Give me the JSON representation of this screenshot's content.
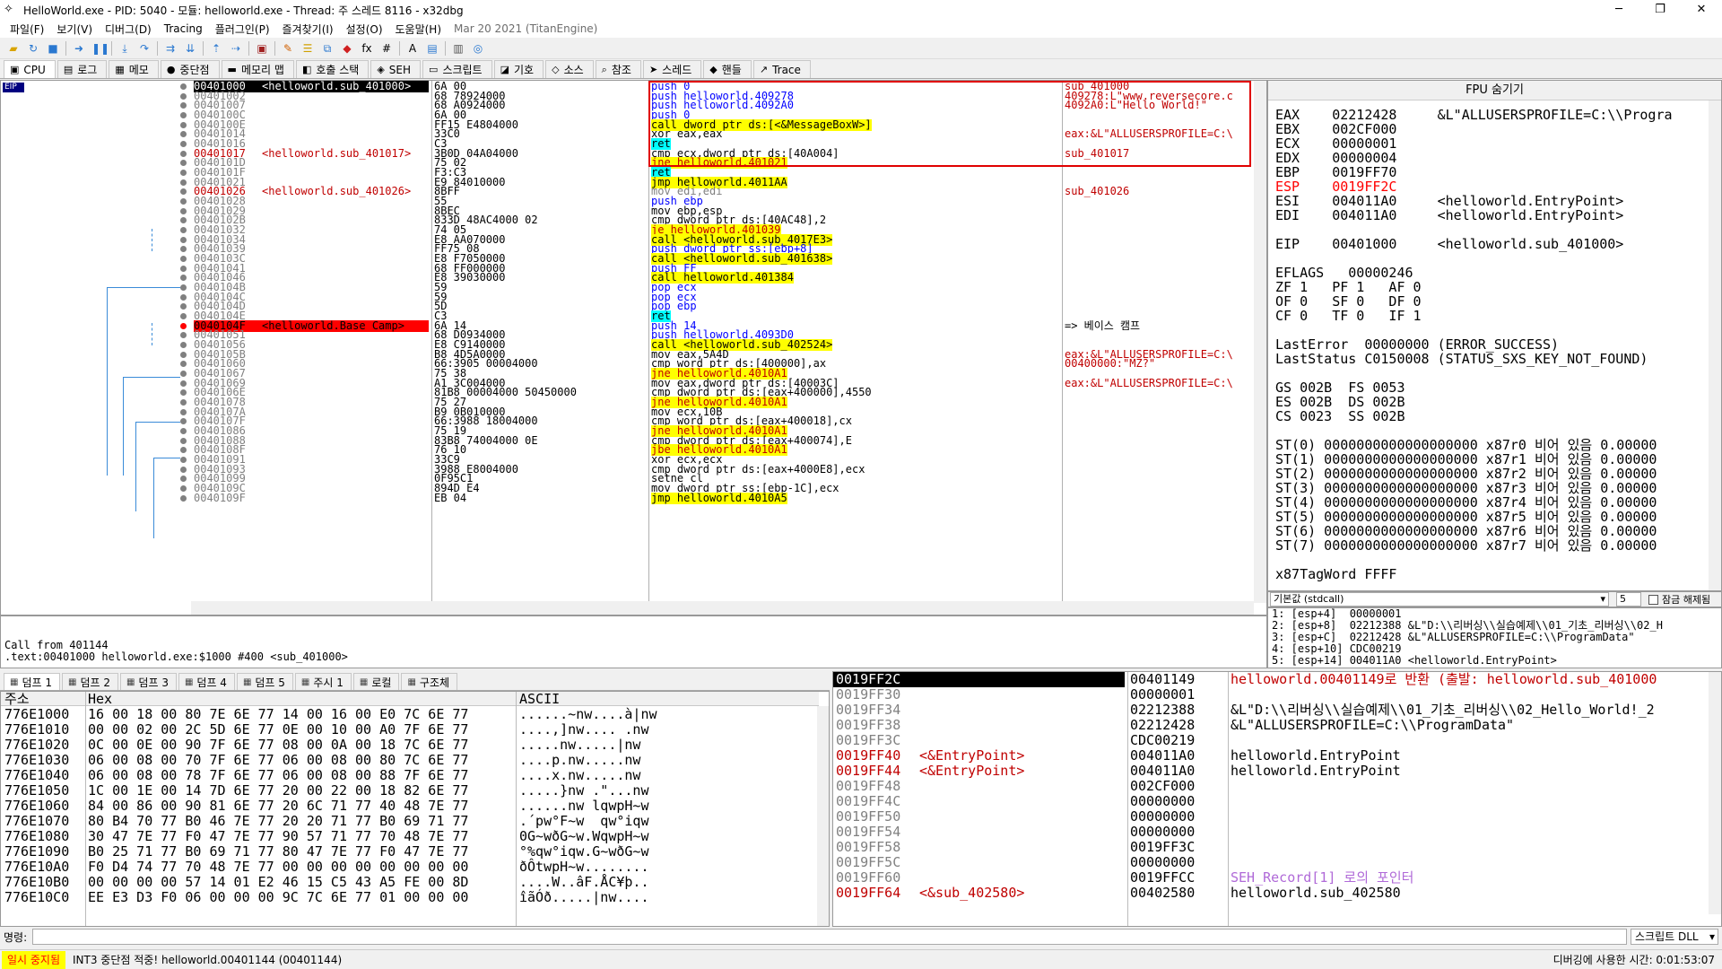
{
  "titlebar": {
    "title": "HelloWorld.exe - PID: 5040 - 모듈: helloworld.exe - Thread: 주 스레드 8116 - x32dbg",
    "minimize": "─",
    "maximize": "❐",
    "close": "✕"
  },
  "menu": [
    "파일(F)",
    "보기(V)",
    "디버그(D)",
    "Tracing",
    "플러그인(P)",
    "즐겨찾기(I)",
    "설정(O)",
    "도움말(H)"
  ],
  "menu_dim": "Mar 20 2021 (TitanEngine)",
  "tabs": [
    {
      "icon": "cpu-icon",
      "glyph": "▣",
      "label": "CPU"
    },
    {
      "icon": "log-icon",
      "glyph": "▤",
      "label": "로그"
    },
    {
      "icon": "notes-icon",
      "glyph": "▦",
      "label": "메모"
    },
    {
      "icon": "breakpoint-icon",
      "glyph": "●",
      "label": "중단점"
    },
    {
      "icon": "memory-icon",
      "glyph": "▬",
      "label": "메모리 맵"
    },
    {
      "icon": "callstack-icon",
      "glyph": "◧",
      "label": "호출 스택"
    },
    {
      "icon": "seh-icon",
      "glyph": "◈",
      "label": "SEH"
    },
    {
      "icon": "script-icon",
      "glyph": "▭",
      "label": "스크립트"
    },
    {
      "icon": "symbol-icon",
      "glyph": "◪",
      "label": "기호"
    },
    {
      "icon": "source-icon",
      "glyph": "◇",
      "label": "소스"
    },
    {
      "icon": "reference-icon",
      "glyph": "⌕",
      "label": "참조"
    },
    {
      "icon": "threads-icon",
      "glyph": "➤",
      "label": "스레드"
    },
    {
      "icon": "handles-icon",
      "glyph": "◆",
      "label": "핸들"
    },
    {
      "icon": "trace-icon",
      "glyph": "↗",
      "label": "Trace"
    }
  ],
  "cpu": {
    "eip_badge": "EIP",
    "rows": [
      {
        "addr": "00401000",
        "label": "<helloworld.sub_401000>",
        "bytes": "6A 00",
        "dis": "push 0",
        "op": "push",
        "cmt": "sub_401000",
        "eip": true
      },
      {
        "addr": "00401002",
        "bytes": "68 78924000",
        "dis": "push helloworld.409278",
        "op": "push",
        "cmt": "409278:L\"www.reversecore.c"
      },
      {
        "addr": "00401007",
        "bytes": "68 A0924000",
        "dis": "push helloworld.4092A0",
        "op": "push",
        "cmt": "4092A0:L\"Hello World!\""
      },
      {
        "addr": "0040100C",
        "bytes": "6A 00",
        "dis": "push 0",
        "op": "push",
        "cmt": ""
      },
      {
        "addr": "0040100E",
        "bytes": "FF15 E4804000",
        "dis": "call dword ptr ds:[<&MessageBoxW>]",
        "op": "call",
        "cmt": ""
      },
      {
        "addr": "00401014",
        "bytes": "33C0",
        "dis": "xor eax,eax",
        "op": "",
        "cmt": "eax:&L\"ALLUSERSPROFILE=C:\\"
      },
      {
        "addr": "00401016",
        "bytes": "C3",
        "dis": "ret",
        "op": "ret",
        "cmt": ""
      },
      {
        "addr": "00401017",
        "label": "<helloworld.sub_401017>",
        "bytes": "3B0D 04A04000",
        "dis": "cmp ecx,dword ptr ds:[40A004]",
        "op": "",
        "cmt": "sub_401017"
      },
      {
        "addr": "0040101D",
        "bytes": "75 02",
        "dis": "jne helloworld.401021",
        "op": "jcc",
        "cmt": ""
      },
      {
        "addr": "0040101F",
        "bytes": "F3:C3",
        "dis": "ret",
        "op": "ret",
        "cmt": ""
      },
      {
        "addr": "00401021",
        "bytes": "E9 84010000",
        "dis": "jmp helloworld.4011AA",
        "op": "jmp",
        "cmt": ""
      },
      {
        "addr": "00401026",
        "label": "<helloworld.sub_401026>",
        "bytes": "8BFF",
        "dis": "mov edi,edi",
        "op": "dim",
        "cmt": "sub_401026"
      },
      {
        "addr": "00401028",
        "bytes": "55",
        "dis": "push ebp",
        "op": "push",
        "cmt": ""
      },
      {
        "addr": "00401029",
        "bytes": "8BEC",
        "dis": "mov ebp,esp",
        "op": "",
        "cmt": ""
      },
      {
        "addr": "0040102B",
        "bytes": "833D 48AC4000 02",
        "dis": "cmp dword ptr ds:[40AC48],2",
        "op": "",
        "cmt": ""
      },
      {
        "addr": "00401032",
        "bytes": "74 05",
        "dis": "je helloworld.401039",
        "op": "jcc",
        "cmt": ""
      },
      {
        "addr": "00401034",
        "bytes": "E8 AA070000",
        "dis": "call <helloworld.sub_4017E3>",
        "op": "call",
        "cmt": ""
      },
      {
        "addr": "00401039",
        "bytes": "FF75 08",
        "dis": "push dword ptr ss:[ebp+8]",
        "op": "push",
        "cmt": ""
      },
      {
        "addr": "0040103C",
        "bytes": "E8 F7050000",
        "dis": "call <helloworld.sub_401638>",
        "op": "call",
        "cmt": ""
      },
      {
        "addr": "00401041",
        "bytes": "68 FF000000",
        "dis": "push FF",
        "op": "push",
        "cmt": ""
      },
      {
        "addr": "00401046",
        "bytes": "E8 39030000",
        "dis": "call helloworld.401384",
        "op": "call",
        "cmt": ""
      },
      {
        "addr": "0040104B",
        "bytes": "59",
        "dis": "pop ecx",
        "op": "push",
        "cmt": ""
      },
      {
        "addr": "0040104C",
        "bytes": "59",
        "dis": "pop ecx",
        "op": "push",
        "cmt": ""
      },
      {
        "addr": "0040104D",
        "bytes": "5D",
        "dis": "pop ebp",
        "op": "push",
        "cmt": ""
      },
      {
        "addr": "0040104E",
        "bytes": "C3",
        "dis": "ret",
        "op": "ret",
        "cmt": ""
      },
      {
        "addr": "0040104F",
        "label": "<helloworld.Base Camp>",
        "bytes": "6A 14",
        "dis": "push 14",
        "op": "push",
        "cmt": "=> 베이스 캠프",
        "bp": true
      },
      {
        "addr": "00401051",
        "bytes": "68 D0934000",
        "dis": "push helloworld.4093D0",
        "op": "push",
        "cmt": ""
      },
      {
        "addr": "00401056",
        "bytes": "E8 C9140000",
        "dis": "call <helloworld.sub_402524>",
        "op": "call",
        "cmt": ""
      },
      {
        "addr": "0040105B",
        "bytes": "B8 4D5A0000",
        "dis": "mov eax,5A4D",
        "op": "",
        "cmt": "eax:&L\"ALLUSERSPROFILE=C:\\"
      },
      {
        "addr": "00401060",
        "bytes": "66:3905 00004000",
        "dis": "cmp word ptr ds:[400000],ax",
        "op": "",
        "cmt": "00400000:\"MZ?\""
      },
      {
        "addr": "00401067",
        "bytes": "75 38",
        "dis": "jne helloworld.4010A1",
        "op": "jcc",
        "cmt": ""
      },
      {
        "addr": "00401069",
        "bytes": "A1 3C004000",
        "dis": "mov eax,dword ptr ds:[40003C]",
        "op": "",
        "cmt": "eax:&L\"ALLUSERSPROFILE=C:\\"
      },
      {
        "addr": "0040106E",
        "bytes": "81B8 00004000 50450000",
        "dis": "cmp dword ptr ds:[eax+400000],4550",
        "op": "",
        "cmt": ""
      },
      {
        "addr": "00401078",
        "bytes": "75 27",
        "dis": "jne helloworld.4010A1",
        "op": "jcc",
        "cmt": ""
      },
      {
        "addr": "0040107A",
        "bytes": "B9 0B010000",
        "dis": "mov ecx,10B",
        "op": "",
        "cmt": ""
      },
      {
        "addr": "0040107F",
        "bytes": "66:3988 18004000",
        "dis": "cmp word ptr ds:[eax+400018],cx",
        "op": "",
        "cmt": ""
      },
      {
        "addr": "00401086",
        "bytes": "75 19",
        "dis": "jne helloworld.4010A1",
        "op": "jcc",
        "cmt": ""
      },
      {
        "addr": "00401088",
        "bytes": "83B8 74004000 0E",
        "dis": "cmp dword ptr ds:[eax+400074],E",
        "op": "",
        "cmt": ""
      },
      {
        "addr": "0040108F",
        "bytes": "76 10",
        "dis": "jbe helloworld.4010A1",
        "op": "jcc",
        "cmt": ""
      },
      {
        "addr": "00401091",
        "bytes": "33C9",
        "dis": "xor ecx,ecx",
        "op": "",
        "cmt": ""
      },
      {
        "addr": "00401093",
        "bytes": "3988 E8004000",
        "dis": "cmp dword ptr ds:[eax+4000E8],ecx",
        "op": "",
        "cmt": ""
      },
      {
        "addr": "00401099",
        "bytes": "0F95C1",
        "dis": "setne cl",
        "op": "",
        "cmt": ""
      },
      {
        "addr": "0040109C",
        "bytes": "894D E4",
        "dis": "mov dword ptr ss:[ebp-1C],ecx",
        "op": "",
        "cmt": ""
      },
      {
        "addr": "0040109F",
        "bytes": "EB 04",
        "dis": "jmp helloworld.4010A5",
        "op": "jmp",
        "cmt": ""
      }
    ]
  },
  "registers": {
    "header": "FPU 숨기기",
    "lines": [
      {
        "t": "EAX    02212428     &L\"ALLUSERSPROFILE=C:\\\\Progra"
      },
      {
        "t": "EBX    002CF000"
      },
      {
        "t": "ECX    00000001"
      },
      {
        "t": "EDX    00000004"
      },
      {
        "t": "EBP    0019FF70"
      },
      {
        "t": "ESP    0019FF2C",
        "red": true
      },
      {
        "t": "ESI    004011A0     <helloworld.EntryPoint>"
      },
      {
        "t": "EDI    004011A0     <helloworld.EntryPoint>"
      },
      {
        "t": ""
      },
      {
        "t": "EIP    00401000     <helloworld.sub_401000>"
      },
      {
        "t": ""
      },
      {
        "t": "EFLAGS   00000246"
      },
      {
        "t": "ZF 1   PF 1   AF 0"
      },
      {
        "t": "OF 0   SF 0   DF 0"
      },
      {
        "t": "CF 0   TF 0   IF 1"
      },
      {
        "t": ""
      },
      {
        "t": "LastError  00000000 (ERROR_SUCCESS)"
      },
      {
        "t": "LastStatus C0150008 (STATUS_SXS_KEY_NOT_FOUND)"
      },
      {
        "t": ""
      },
      {
        "t": "GS 002B  FS 0053"
      },
      {
        "t": "ES 002B  DS 002B"
      },
      {
        "t": "CS 0023  SS 002B"
      },
      {
        "t": ""
      },
      {
        "t": "ST(0) 0000000000000000000 x87r0 비어 있음 0.00000"
      },
      {
        "t": "ST(1) 0000000000000000000 x87r1 비어 있음 0.00000"
      },
      {
        "t": "ST(2) 0000000000000000000 x87r2 비어 있음 0.00000"
      },
      {
        "t": "ST(3) 0000000000000000000 x87r3 비어 있음 0.00000"
      },
      {
        "t": "ST(4) 0000000000000000000 x87r4 비어 있음 0.00000"
      },
      {
        "t": "ST(5) 0000000000000000000 x87r5 비어 있음 0.00000"
      },
      {
        "t": "ST(6) 0000000000000000000 x87r6 비어 있음 0.00000"
      },
      {
        "t": "ST(7) 0000000000000000000 x87r7 비어 있음 0.00000"
      },
      {
        "t": ""
      },
      {
        "t": "x87TagWord FFFF"
      }
    ]
  },
  "callargs": {
    "convention": "기본값 (stdcall)",
    "count": "5",
    "lock_label": "잠금 해제됨",
    "lines": [
      "1: [esp+4]  00000001",
      "2: [esp+8]  02212388 &L\"D:\\\\리버싱\\\\실습예제\\\\01_기초_리버싱\\\\02_H",
      "3: [esp+C]  02212428 &L\"ALLUSERSPROFILE=C:\\\\ProgramData\"",
      "4: [esp+10] CDC00219",
      "5: [esp+14] 004011A0 <helloworld.EntryPoint>"
    ]
  },
  "info": {
    "line1": "Call from 401144",
    "line2": ".text:00401000 helloworld.exe:$1000 #400 <sub_401000>"
  },
  "dumptabs": [
    "덤프 1",
    "덤프 2",
    "덤프 3",
    "덤프 4",
    "덤프 5",
    "주시 1",
    "로컬",
    "구조체"
  ],
  "dump": {
    "col_addr": "주소",
    "col_hex": "Hex",
    "col_ascii": "ASCII",
    "rows": [
      {
        "addr": "776E1000",
        "hex": "16 00 18 00 80 7E 6E 77 14 00 16 00 E0 7C 6E 77",
        "ascii": "......~nw....à|nw"
      },
      {
        "addr": "776E1010",
        "hex": "00 00 02 00 2C 5D 6E 77 0E 00 10 00 A0 7F 6E 77",
        "ascii": "....,]nw.... .nw"
      },
      {
        "addr": "776E1020",
        "hex": "0C 00 0E 00 90 7F 6E 77 08 00 0A 00 18 7C 6E 77",
        "ascii": ".....nw.....|nw"
      },
      {
        "addr": "776E1030",
        "hex": "06 00 08 00 70 7F 6E 77 06 00 08 00 80 7C 6E 77",
        "ascii": "....p.nw.....nw"
      },
      {
        "addr": "776E1040",
        "hex": "06 00 08 00 78 7F 6E 77 06 00 08 00 88 7F 6E 77",
        "ascii": "....x.nw.....nw"
      },
      {
        "addr": "776E1050",
        "hex": "1C 00 1E 00 14 7D 6E 77 20 00 22 00 18 82 6E 77",
        "ascii": ".....}nw .\"...nw"
      },
      {
        "addr": "776E1060",
        "hex": "84 00 86 00 90 81 6E 77 20 6C 71 77 40 48 7E 77",
        "ascii": "......nw lqwpH~w"
      },
      {
        "addr": "776E1070",
        "hex": "80 B4 70 77 B0 46 7E 77 20 20 71 77 B0 69 71 77",
        "ascii": ".´pw°F~w  qw°iqw"
      },
      {
        "addr": "776E1080",
        "hex": "30 47 7E 77 F0 47 7E 77 90 57 71 77 70 48 7E 77",
        "ascii": "0G~wðG~w.WqwpH~w"
      },
      {
        "addr": "776E1090",
        "hex": "B0 25 71 77 B0 69 71 77 80 47 7E 77 F0 47 7E 77",
        "ascii": "°%qw°iqw.G~wðG~w"
      },
      {
        "addr": "776E10A0",
        "hex": "F0 D4 74 77 70 48 7E 77 00 00 00 00 00 00 00 00",
        "ascii": "ðÔtwpH~w........"
      },
      {
        "addr": "776E10B0",
        "hex": "00 00 00 00 57 14 01 E2 46 15 C5 43 A5 FE 00 8D",
        "ascii": "....W..âF.ÅC¥þ.."
      },
      {
        "addr": "776E10C0",
        "hex": "EE E3 D3 F0 06 00 00 00 9C 7C 6E 77 01 00 00 00",
        "ascii": "îãÓð.....|nw...."
      }
    ]
  },
  "stack": {
    "rows": [
      {
        "addr": "0019FF2C",
        "lbl": "",
        "val": "00401149",
        "cmt": "helloworld.00401149로 반환 (출발: helloworld.sub_401000",
        "cmtc": "red",
        "sel": true
      },
      {
        "addr": "0019FF30",
        "lbl": "",
        "val": "00000001",
        "cmt": ""
      },
      {
        "addr": "0019FF34",
        "lbl": "",
        "val": "02212388",
        "cmt": "&L\"D:\\\\리버싱\\\\실습예제\\\\01_기초_리버싱\\\\02_Hello_World!_2"
      },
      {
        "addr": "0019FF38",
        "lbl": "",
        "val": "02212428",
        "cmt": "&L\"ALLUSERSPROFILE=C:\\\\ProgramData\""
      },
      {
        "addr": "0019FF3C",
        "lbl": "",
        "val": "CDC00219",
        "cmt": ""
      },
      {
        "addr": "0019FF40",
        "lbl": "<&EntryPoint>",
        "val": "004011A0",
        "cmt": "helloworld.EntryPoint"
      },
      {
        "addr": "0019FF44",
        "lbl": "<&EntryPoint>",
        "val": "004011A0",
        "cmt": "helloworld.EntryPoint"
      },
      {
        "addr": "0019FF48",
        "lbl": "",
        "val": "002CF000",
        "cmt": ""
      },
      {
        "addr": "0019FF4C",
        "lbl": "",
        "val": "00000000",
        "cmt": ""
      },
      {
        "addr": "0019FF50",
        "lbl": "",
        "val": "00000000",
        "cmt": ""
      },
      {
        "addr": "0019FF54",
        "lbl": "",
        "val": "00000000",
        "cmt": ""
      },
      {
        "addr": "0019FF58",
        "lbl": "",
        "val": "0019FF3C",
        "cmt": ""
      },
      {
        "addr": "0019FF5C",
        "lbl": "",
        "val": "00000000",
        "cmt": ""
      },
      {
        "addr": "0019FF60",
        "lbl": "",
        "val": "0019FFCC",
        "cmt": "SEH_Record[1] 로의 포인터",
        "cmtc": "purple"
      },
      {
        "addr": "0019FF64",
        "lbl": "<&sub_402580>",
        "val": "00402580",
        "cmt": "helloworld.sub_402580"
      }
    ]
  },
  "cmdbar": {
    "label": "명령:",
    "dll": "스크립트 DLL"
  },
  "status": {
    "paused": "일시 중지됨",
    "msg": "INT3 중단점 적중! helloworld.00401144 (00401144)",
    "time": "디버깅에 사용한 시간: 0:01:53:07"
  },
  "colors": {
    "eip": "#000080",
    "breakpoint": "#ff0000",
    "highlight_yellow": "#ffff00",
    "highlight_cyan": "#00ffff",
    "comment_red": "#c00000"
  }
}
